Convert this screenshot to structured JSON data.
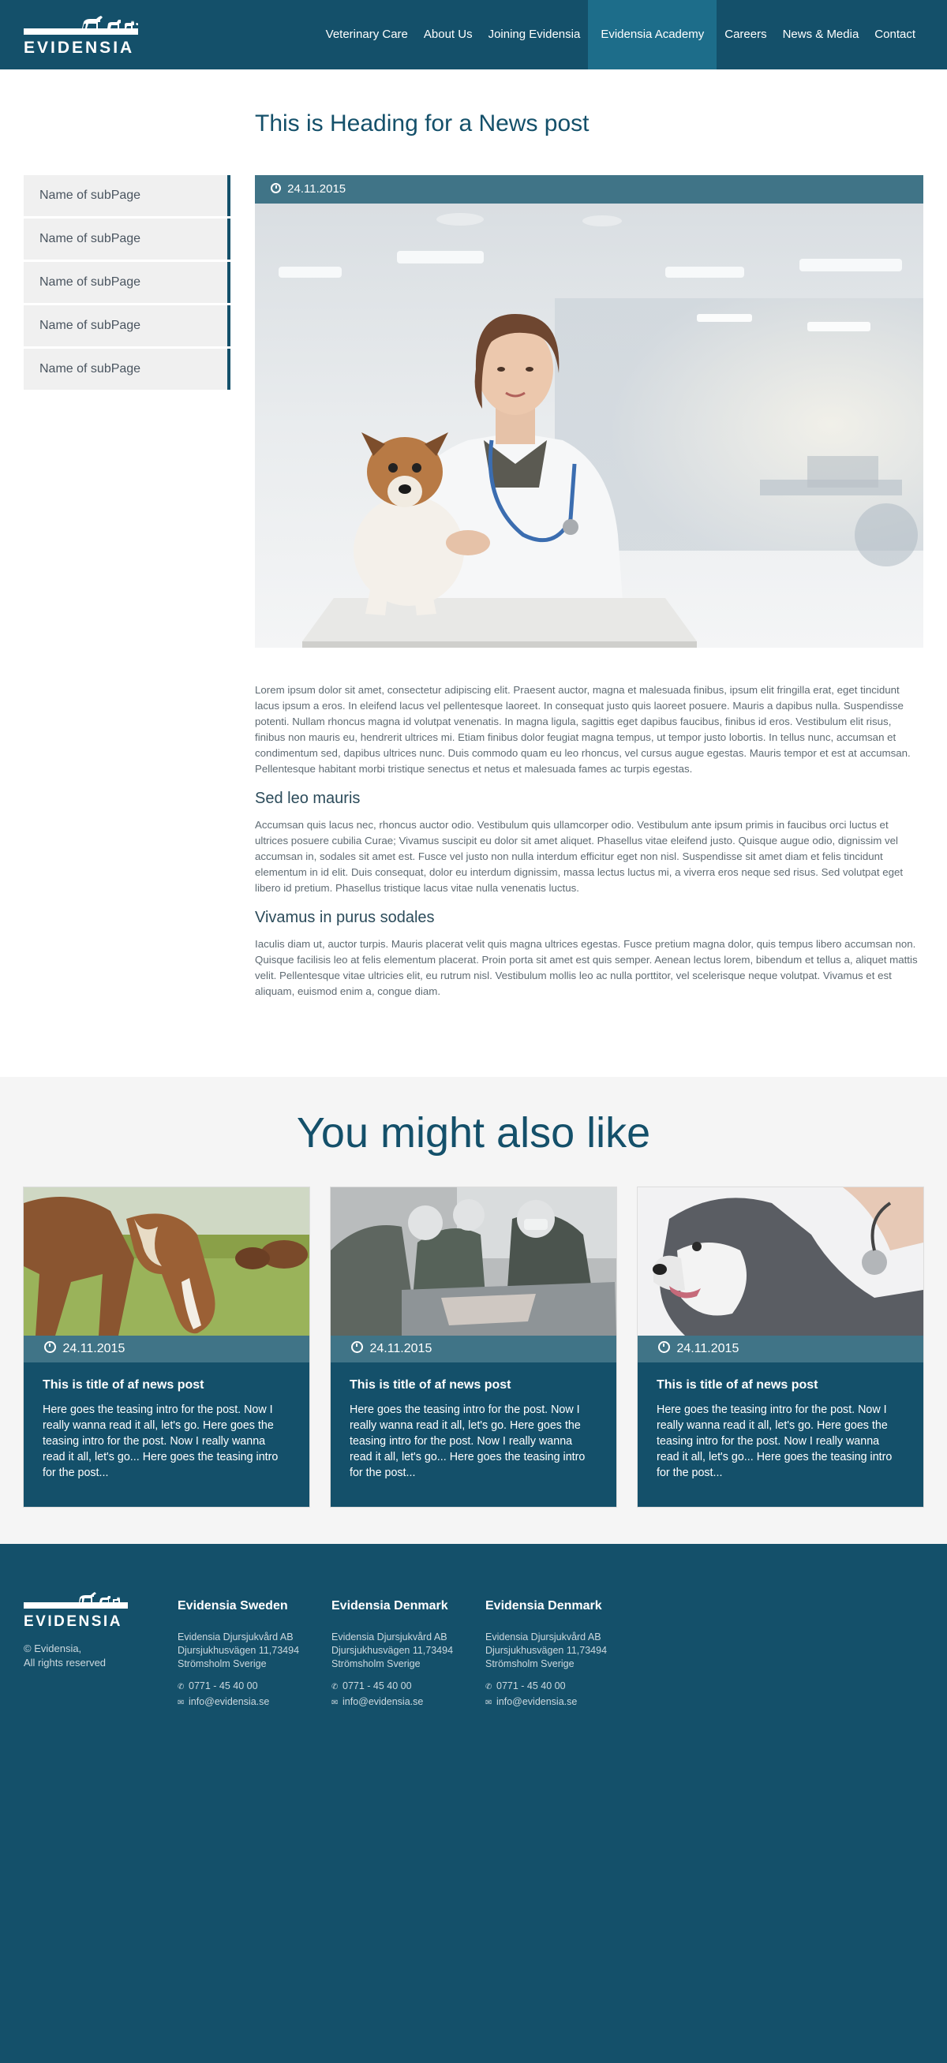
{
  "brand": {
    "name": "EVIDENSIA"
  },
  "nav": {
    "items": [
      {
        "label": "Veterinary Care"
      },
      {
        "label": "About Us"
      },
      {
        "label": "Joining Evidensia"
      },
      {
        "label": "Evidensia Academy",
        "active": true
      },
      {
        "label": "Careers"
      },
      {
        "label": "News & Media"
      },
      {
        "label": "Contact"
      }
    ]
  },
  "page": {
    "title": "This is Heading for a News post"
  },
  "subnav": {
    "items": [
      {
        "label": "Name of subPage"
      },
      {
        "label": "Name of subPage"
      },
      {
        "label": "Name of subPage"
      },
      {
        "label": "Name of subPage"
      },
      {
        "label": "Name of subPage"
      }
    ]
  },
  "post": {
    "date": "24.11.2015",
    "paragraph1": "Lorem ipsum dolor sit amet, consectetur adipiscing elit. Praesent auctor, magna et malesuada finibus, ipsum elit fringilla erat, eget tincidunt lacus ipsum a eros. In eleifend lacus vel pellentesque laoreet. In consequat justo quis laoreet posuere. Mauris a dapibus nulla. Suspendisse potenti. Nullam rhoncus magna id volutpat venenatis. In magna ligula, sagittis eget dapibus faucibus, finibus id eros. Vestibulum elit risus, finibus non mauris eu, hendrerit ultrices mi. Etiam finibus dolor feugiat magna tempus, ut tempor justo lobortis. In tellus nunc, accumsan et condimentum sed, dapibus ultrices nunc. Duis commodo quam eu leo rhoncus, vel cursus augue egestas. Mauris tempor et est at accumsan. Pellentesque habitant morbi tristique senectus et netus et malesuada fames ac turpis egestas.",
    "heading2": "Sed leo mauris",
    "paragraph2": "Accumsan quis lacus nec, rhoncus auctor odio. Vestibulum quis ullamcorper odio. Vestibulum ante ipsum primis in faucibus orci luctus et ultrices posuere cubilia Curae; Vivamus suscipit eu dolor sit amet aliquet. Phasellus vitae eleifend justo. Quisque augue odio, dignissim vel accumsan in, sodales sit amet est. Fusce vel justo non nulla interdum efficitur eget non nisl. Suspendisse sit amet diam et felis tincidunt elementum in id elit. Duis consequat, dolor eu interdum dignissim, massa lectus luctus mi, a viverra eros neque sed risus. Sed volutpat eget libero id pretium. Phasellus tristique lacus vitae nulla venenatis luctus.",
    "heading3": "Vivamus in purus sodales",
    "paragraph3": "Iaculis diam ut, auctor turpis. Mauris placerat velit quis magna ultrices egestas. Fusce pretium magna dolor, quis tempus libero accumsan non. Quisque facilisis leo at felis elementum placerat. Proin porta sit amet est quis semper. Aenean lectus lorem, bibendum et tellus a, aliquet mattis velit. Pellentesque vitae ultricies elit, eu rutrum nisl. Vestibulum mollis leo ac nulla porttitor, vel scelerisque neque volutpat. Vivamus et est aliquam, euismod enim a, congue diam."
  },
  "related": {
    "title": "You might also like",
    "cards": [
      {
        "date": "24.11.2015",
        "title": "This is title of af news post",
        "text": "Here goes the teasing intro for the post. Now I really wanna read it all, let's go. Here goes the teasing intro for the post. Now I really wanna read it all, let's go... Here goes the teasing intro for the post..."
      },
      {
        "date": "24.11.2015",
        "title": "This is title of af news post",
        "text": "Here goes the teasing intro for the post. Now I really wanna read it all, let's go. Here goes the teasing intro for the post. Now I really wanna read it all, let's go... Here goes the teasing intro for the post..."
      },
      {
        "date": "24.11.2015",
        "title": "This is title of af news post",
        "text": "Here goes the teasing intro for the post. Now I really wanna read it all, let's go. Here goes the teasing intro for the post. Now I really wanna read it all, let's go... Here goes the teasing intro for the post..."
      }
    ]
  },
  "footer": {
    "copy_line1": "© Evidensia,",
    "copy_line2": "All rights reserved",
    "columns": [
      {
        "title": "Evidensia Sweden",
        "addr1": "Evidensia Djursjukvård AB",
        "addr2": "Djursjukhusvägen 11,73494",
        "addr3": "Strömsholm Sverige",
        "phone": "0771 - 45 40 00",
        "email": "info@evidensia.se"
      },
      {
        "title": "Evidensia Denmark",
        "addr1": "Evidensia Djursjukvård AB",
        "addr2": "Djursjukhusvägen 11,73494",
        "addr3": "Strömsholm Sverige",
        "phone": "0771 - 45 40 00",
        "email": "info@evidensia.se"
      },
      {
        "title": "Evidensia Denmark",
        "addr1": "Evidensia Djursjukvård AB",
        "addr2": "Djursjukhusvägen 11,73494",
        "addr3": "Strömsholm Sverige",
        "phone": "0771 - 45 40 00",
        "email": "info@evidensia.se"
      }
    ]
  },
  "colors": {
    "brand_dark": "#14506a",
    "accent_bar": "#407487",
    "active_nav": "#1d6d8a",
    "light_bg": "#f5f5f5"
  },
  "icons": {
    "date": "clock-icon",
    "phone": "phone-icon",
    "email": "envelope-icon"
  }
}
